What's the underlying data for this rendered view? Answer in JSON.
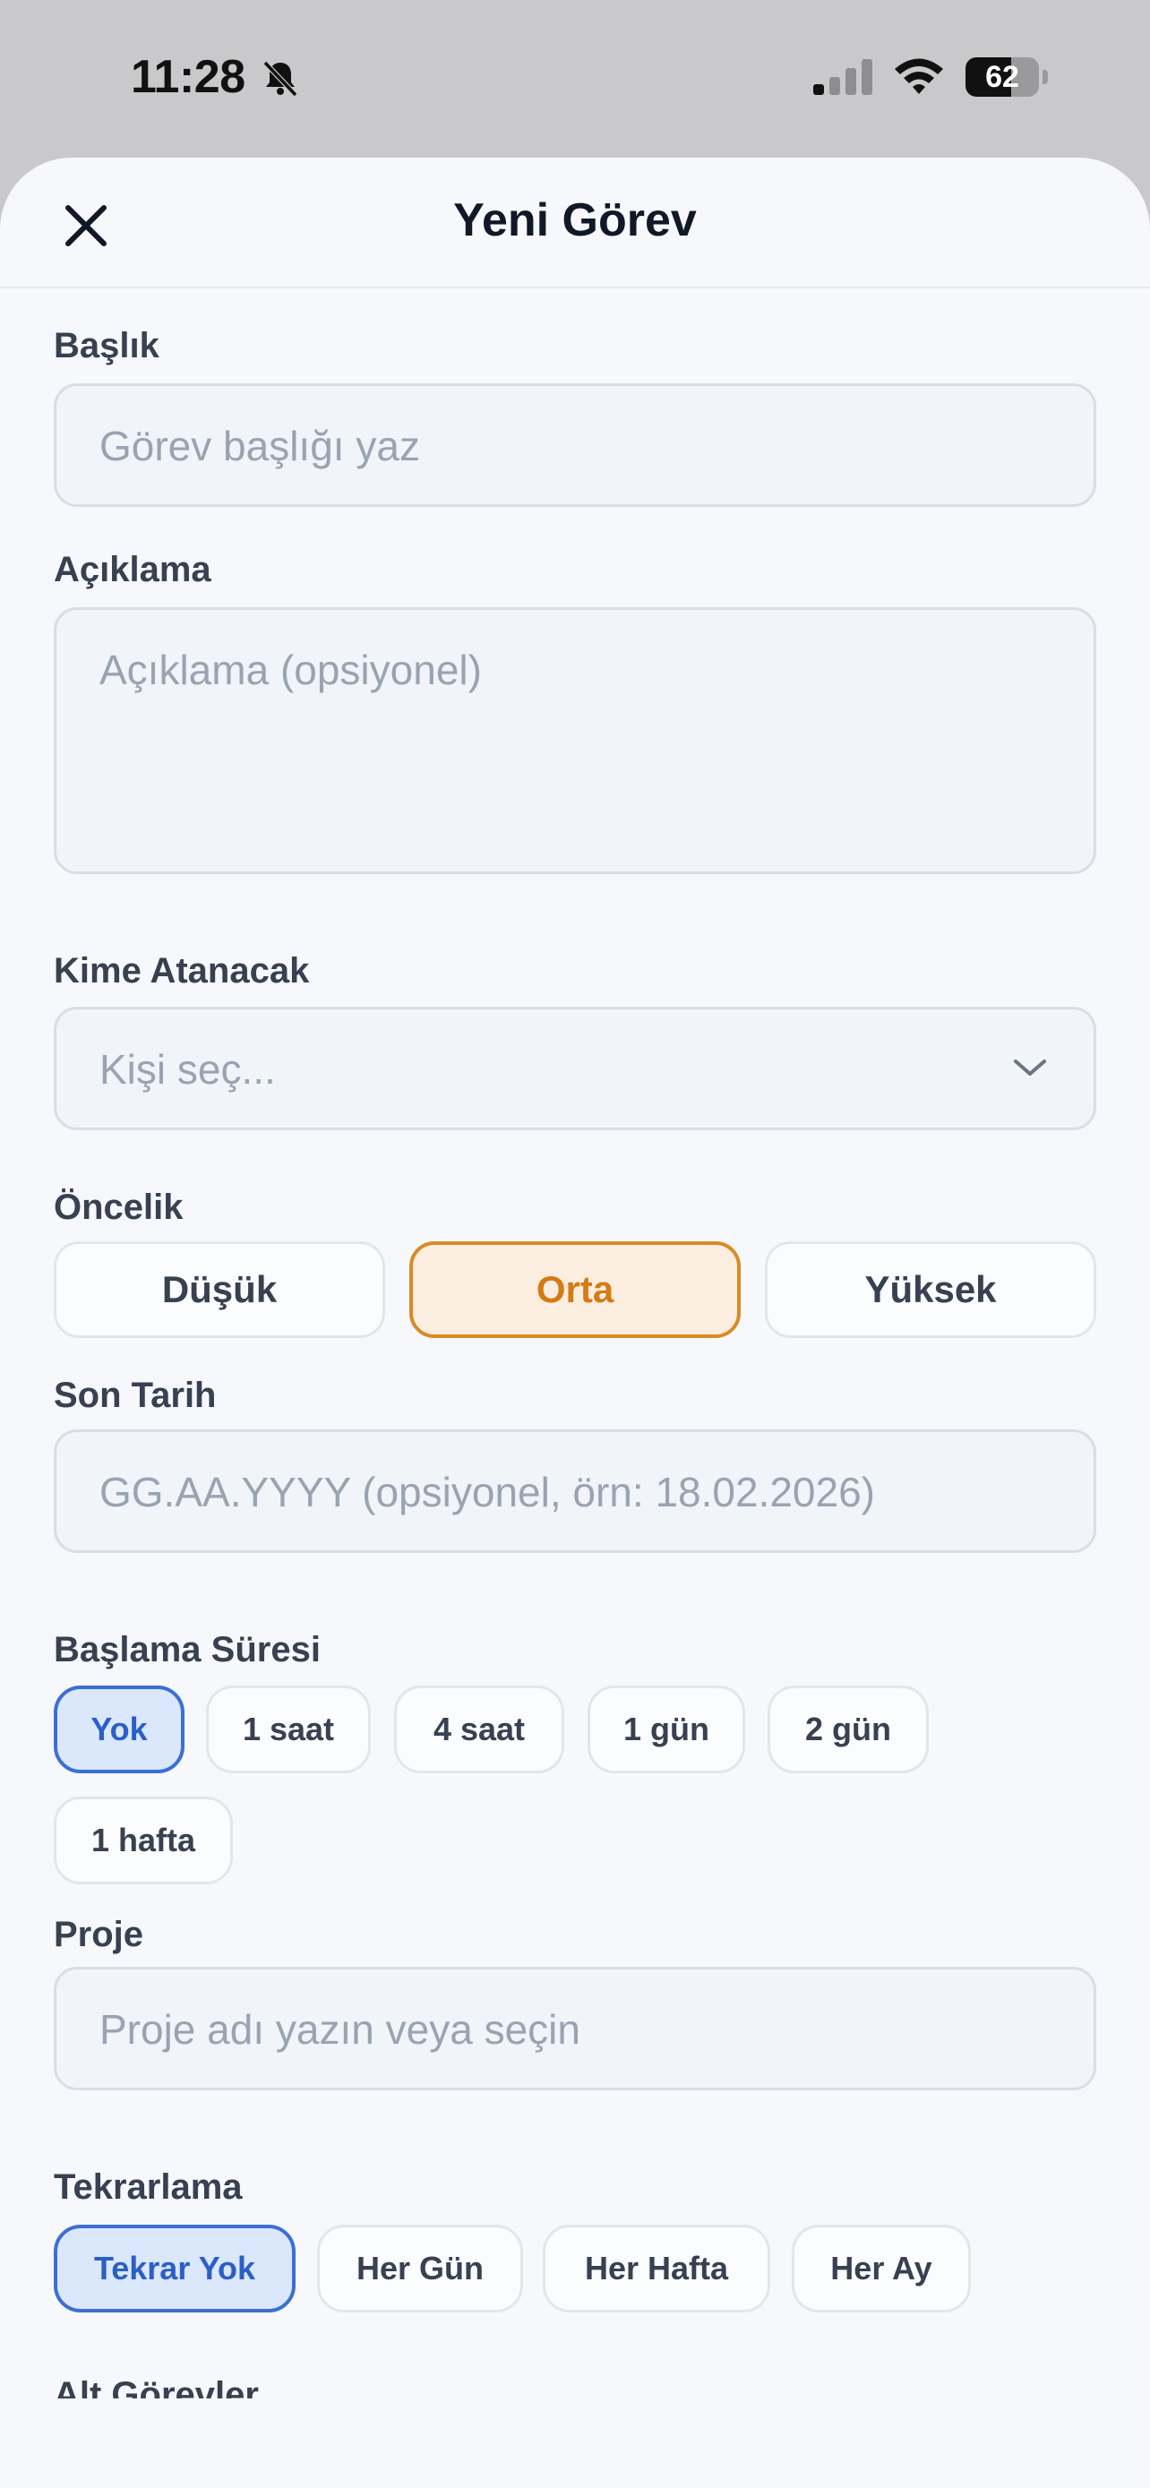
{
  "status_bar": {
    "time": "11:28",
    "battery_percent": 62,
    "battery_label": "62"
  },
  "sheet": {
    "title": "Yeni Görev"
  },
  "form": {
    "title_label": "Başlık",
    "title_placeholder": "Görev başlığı yaz",
    "description_label": "Açıklama",
    "description_placeholder": "Açıklama (opsiyonel)",
    "assignee_label": "Kime Atanacak",
    "assignee_placeholder": "Kişi seç...",
    "priority_label": "Öncelik",
    "priority_options": [
      "Düşük",
      "Orta",
      "Yüksek"
    ],
    "priority_selected": "Orta",
    "due_label": "Son Tarih",
    "due_placeholder": "GG.AA.YYYY (opsiyonel, örn: 18.02.2026)",
    "start_label": "Başlama Süresi",
    "start_options": [
      "Yok",
      "1 saat",
      "4 saat",
      "1 gün",
      "2 gün",
      "1 hafta"
    ],
    "start_selected": "Yok",
    "project_label": "Proje",
    "project_placeholder": "Proje adı yazın veya seçin",
    "repeat_label": "Tekrarlama",
    "repeat_options": [
      "Tekrar Yok",
      "Her Gün",
      "Her Hafta",
      "Her Ay"
    ],
    "repeat_selected": "Tekrar Yok",
    "subtasks_label": "Alt Görevler"
  },
  "colors": {
    "accent_orange": "#d57a14",
    "accent_blue": "#2a5fc8",
    "sheet_bg": "#f7f8fb"
  },
  "icons": {
    "close": "close-icon",
    "chevron": "chevron-down-icon",
    "bell": "bell-slash-icon",
    "signal": "cellular-signal-icon",
    "wifi": "wifi-icon",
    "battery": "battery-icon"
  }
}
